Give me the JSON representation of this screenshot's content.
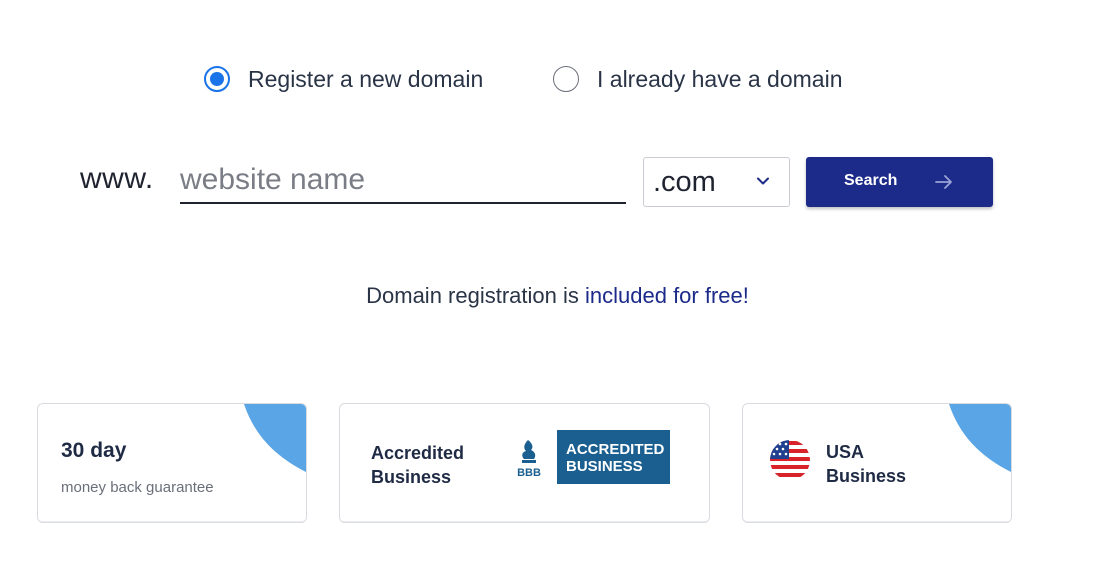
{
  "domain_mode": {
    "options": [
      {
        "label": "Register a new domain",
        "selected": true
      },
      {
        "label": "I already have a domain",
        "selected": false
      }
    ]
  },
  "search": {
    "prefix": "www.",
    "placeholder": "website name",
    "value": "",
    "tld_selected": ".com",
    "button_label": "Search",
    "icons": {
      "tld_toggle": "chevron-down-icon",
      "button": "arrow-right-icon"
    }
  },
  "note": {
    "text": "Domain registration is ",
    "highlight": "included for free!",
    "highlight_color": "#1c2a8a"
  },
  "cards": {
    "guarantee": {
      "title": "30 day",
      "subtitle": "money back guarantee"
    },
    "bbb": {
      "line1": "Accredited",
      "line2": "Business",
      "badge_line1": "ACCREDITED",
      "badge_line2": "BUSINESS",
      "logo_text": "BBB"
    },
    "usa": {
      "line1": "USA",
      "line2": "Business",
      "icon": "us-flag-icon"
    }
  },
  "colors": {
    "primary_button": "#1c2a8a",
    "radio_selected": "#1a73e8",
    "corner_accent": "#5aa5e6",
    "bbb_blue": "#1a5f8f"
  }
}
